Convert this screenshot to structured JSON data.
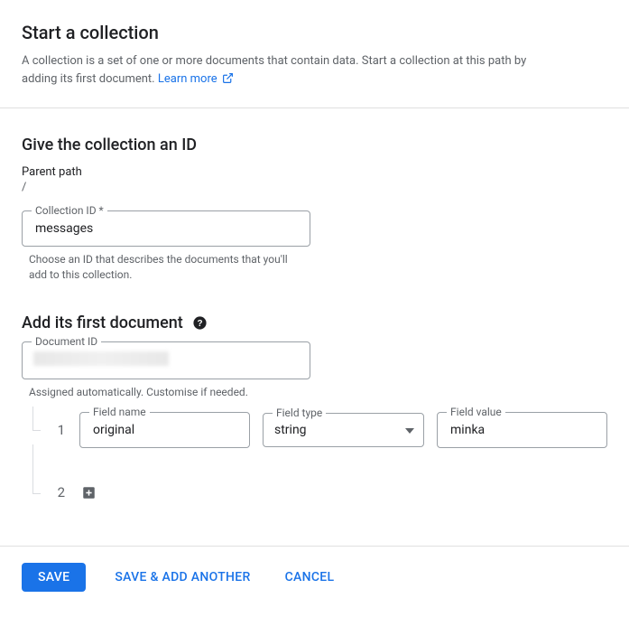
{
  "header": {
    "title": "Start a collection",
    "description": "A collection is a set of one or more documents that contain data. Start a collection at this path by adding its first document.",
    "learn_more": "Learn more"
  },
  "collection": {
    "heading": "Give the collection an ID",
    "parent_path_label": "Parent path",
    "parent_path_value": "/",
    "id_label": "Collection ID *",
    "id_value": "messages",
    "id_helper": "Choose an ID that describes the documents that you'll add to this collection."
  },
  "document": {
    "heading": "Add its first document",
    "doc_id_label": "Document ID",
    "doc_id_helper": "Assigned automatically. Customise if needed.",
    "row_indices": {
      "r1": "1",
      "r2": "2"
    },
    "field_name_label": "Field name",
    "field_type_label": "Field type",
    "field_value_label": "Field value",
    "fields": [
      {
        "name": "original",
        "type": "string",
        "value": "minka"
      }
    ]
  },
  "actions": {
    "save": "SAVE",
    "save_another": "SAVE & ADD ANOTHER",
    "cancel": "CANCEL"
  }
}
